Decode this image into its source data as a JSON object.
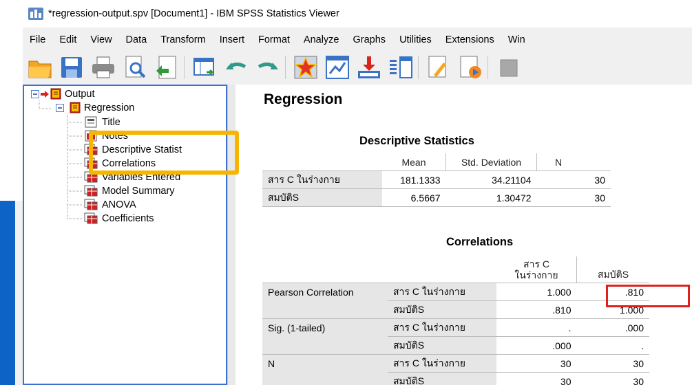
{
  "window": {
    "title": "*regression-output.spv [Document1] - IBM SPSS Statistics Viewer"
  },
  "menu": [
    "File",
    "Edit",
    "View",
    "Data",
    "Transform",
    "Insert",
    "Format",
    "Analyze",
    "Graphs",
    "Utilities",
    "Extensions",
    "Win"
  ],
  "toolbar": [
    "open-folder-icon",
    "save-icon",
    "print-icon",
    "print-preview-icon",
    "export-icon",
    "goto-data-icon",
    "undo-icon",
    "redo-icon",
    "star-icon",
    "chart-editor-icon",
    "designate-window-icon",
    "variables-icon",
    "edit-icon",
    "insert-text-icon"
  ],
  "outline": {
    "root": "Output",
    "group": "Regression",
    "items": [
      "Title",
      "Notes",
      "Descriptive Statist",
      "Correlations",
      "Variables Entered",
      "Model Summary",
      "ANOVA",
      "Coefficients"
    ]
  },
  "output": {
    "heading": "Regression",
    "descriptive": {
      "title": "Descriptive Statistics",
      "columns": [
        "Mean",
        "Std. Deviation",
        "N"
      ],
      "rows": [
        {
          "label": "สาร C ในร่างกาย",
          "mean": "181.1333",
          "sd": "34.21104",
          "n": "30"
        },
        {
          "label": "สมบัติS",
          "mean": "6.5667",
          "sd": "1.30472",
          "n": "30"
        }
      ]
    },
    "correlations": {
      "title": "Correlations",
      "col1_line1": "สาร C",
      "col1_line2": "ในร่างกาย",
      "col2": "สมบัติS",
      "rows": [
        {
          "group": "Pearson Correlation",
          "var": "สาร C ในร่างกาย",
          "c1": "1.000",
          "c2": ".810"
        },
        {
          "group": "",
          "var": "สมบัติS",
          "c1": ".810",
          "c2": "1.000"
        },
        {
          "group": "Sig. (1-tailed)",
          "var": "สาร C ในร่างกาย",
          "c1": ".",
          "c2": ".000"
        },
        {
          "group": "",
          "var": "สมบัติS",
          "c1": ".000",
          "c2": "."
        },
        {
          "group": "N",
          "var": "สาร C ในร่างกาย",
          "c1": "30",
          "c2": "30"
        },
        {
          "group": "",
          "var": "สมบัติS",
          "c1": "30",
          "c2": "30"
        }
      ]
    }
  },
  "annotations": {
    "yellow_box_color": "#f7b500",
    "red_box_color": "#e0201b"
  }
}
